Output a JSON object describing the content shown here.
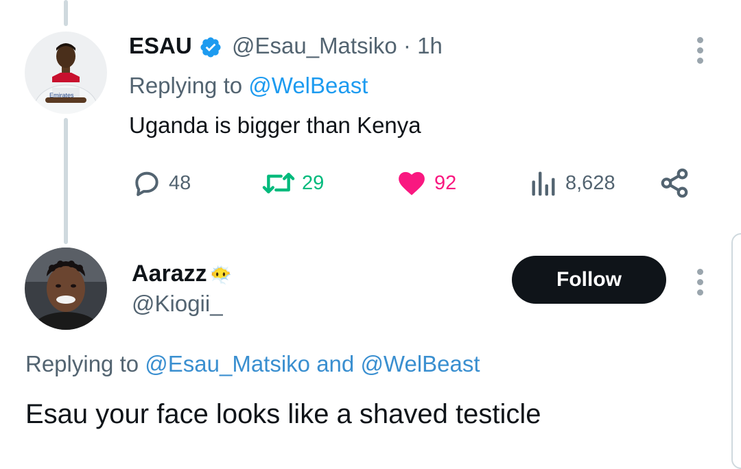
{
  "tweet_1": {
    "display_name": "ESAU",
    "verified_icon": "verified-badge-icon",
    "handle_time": "@Esau_Matsiko · 1h",
    "replying_prefix": "Replying to ",
    "replying_mention": "@WelBeast",
    "text": "Uganda is bigger than Kenya",
    "actions": {
      "replies": "48",
      "retweets": "29",
      "likes": "92",
      "views": "8,628"
    }
  },
  "tweet_2": {
    "display_name": "Aarazz",
    "emoji": "😶‍🌫️",
    "handle": "@Kiogii_",
    "follow_label": "Follow",
    "replying_prefix": "Replying to ",
    "replying_mention_1": "@Esau_Matsiko",
    "replying_and": " and ",
    "replying_mention_2": "@WelBeast",
    "text": "Esau your face looks like a shaved testicle"
  },
  "colors": {
    "accent": "#1d9bf0",
    "retweet": "#00ba7c",
    "like": "#f91880",
    "secondary_text": "#536471"
  }
}
